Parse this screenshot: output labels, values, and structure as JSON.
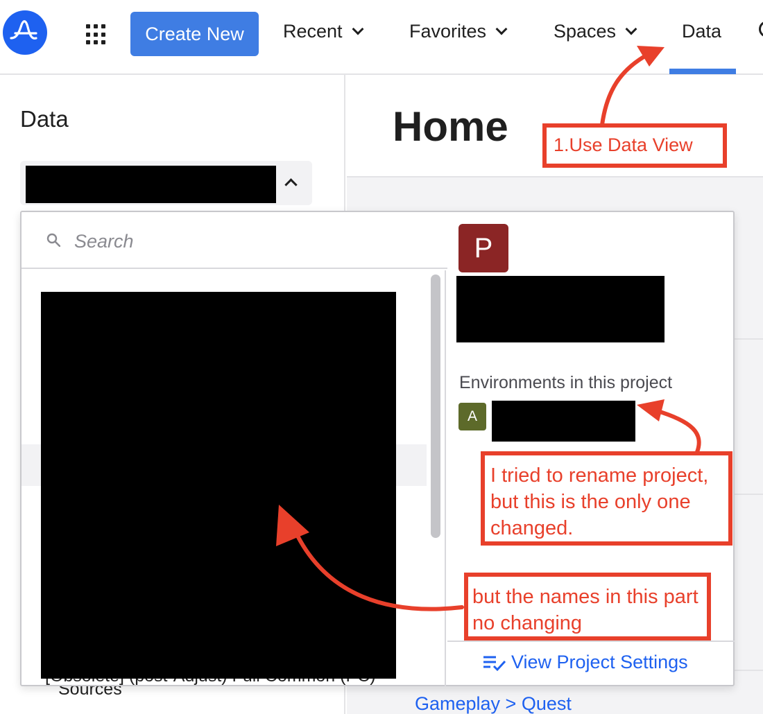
{
  "nav": {
    "create_label": "Create New",
    "recent_label": "Recent",
    "favorites_label": "Favorites",
    "spaces_label": "Spaces",
    "data_label": "Data",
    "accent_color": "#3f7de3",
    "icons": [
      "amplitude-logo-icon",
      "app-grid-icon",
      "chevron-down-icon"
    ]
  },
  "left": {
    "title": "Data",
    "bottom_item": "Sources"
  },
  "main": {
    "title": "Home",
    "breadcrumb_link": "Gameplay > Quest"
  },
  "dropdown": {
    "search_placeholder": "Search",
    "list_partial_text": "[Obsolete] (post-Adjust) Full Common (PC)"
  },
  "preview": {
    "avatar_letter": "P",
    "avatar_color": "#8b2525",
    "environments_title": "Environments in this project",
    "env_badge_letter": "A",
    "env_badge_color": "#5d6a2a",
    "settings_link": "View Project Settings"
  },
  "annotations": {
    "color": "#e8402b",
    "note_1": "1.Use Data View",
    "note_2": "I tried to rename project, but this is the only one changed.",
    "note_3": "but the names in this part no changing"
  }
}
